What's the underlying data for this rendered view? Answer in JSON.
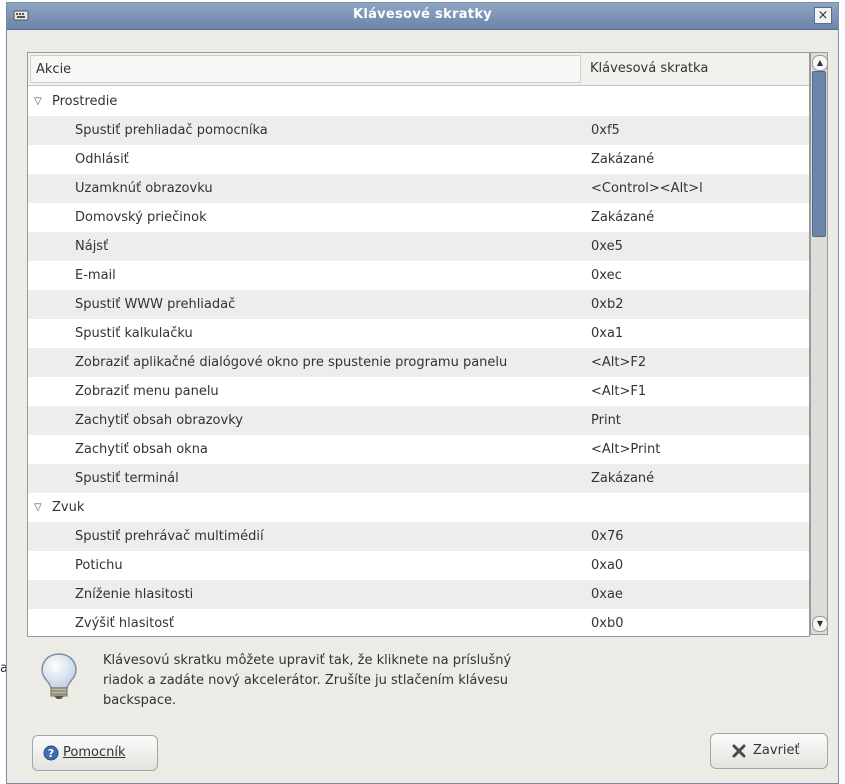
{
  "window": {
    "title": "Klávesové skratky",
    "close_glyph": "×"
  },
  "tree": {
    "columns": {
      "action": "Akcie",
      "shortcut": "Klávesová skratka"
    },
    "groups": [
      {
        "label": "Prostredie",
        "rows": [
          {
            "action": "Spustiť prehliadač pomocníka",
            "shortcut": "0xf5"
          },
          {
            "action": "Odhlásiť",
            "shortcut": "Zakázané"
          },
          {
            "action": "Uzamknúť obrazovku",
            "shortcut": "<Control><Alt>l"
          },
          {
            "action": "Domovský priečinok",
            "shortcut": "Zakázané"
          },
          {
            "action": "Nájsť",
            "shortcut": "0xe5"
          },
          {
            "action": "E-mail",
            "shortcut": "0xec"
          },
          {
            "action": "Spustiť WWW prehliadač",
            "shortcut": "0xb2"
          },
          {
            "action": "Spustiť kalkulačku",
            "shortcut": "0xa1"
          },
          {
            "action": "Zobraziť aplikačné dialógové okno pre spustenie programu panelu",
            "shortcut": "<Alt>F2"
          },
          {
            "action": "Zobraziť menu panelu",
            "shortcut": "<Alt>F1"
          },
          {
            "action": "Zachytiť obsah obrazovky",
            "shortcut": "Print"
          },
          {
            "action": "Zachytiť obsah okna",
            "shortcut": "<Alt>Print"
          },
          {
            "action": "Spustiť terminál",
            "shortcut": "Zakázané"
          }
        ]
      },
      {
        "label": "Zvuk",
        "rows": [
          {
            "action": "Spustiť prehrávač multimédií",
            "shortcut": "0x76"
          },
          {
            "action": "Potichu",
            "shortcut": "0xa0"
          },
          {
            "action": "Zníženie hlasitosti",
            "shortcut": "0xae"
          },
          {
            "action": "Zvýšiť hlasitosť",
            "shortcut": "0xb0"
          }
        ]
      }
    ]
  },
  "hint": {
    "icon": "lightbulb-icon",
    "text": "Klávesovú skratku môžete upraviť tak, že kliknete na príslušný riadok a zadáte nový akcelerátor. Zrušíte ju stlačením klávesu backspace."
  },
  "stray_char": "a",
  "buttons": {
    "help": {
      "label": "Pomocník",
      "icon": "help-icon"
    },
    "close": {
      "label": "Zavrieť",
      "icon": "close-x-icon"
    }
  },
  "colors": {
    "titlebar": "#7890b3",
    "scroll_thumb": "#6c86ab"
  }
}
